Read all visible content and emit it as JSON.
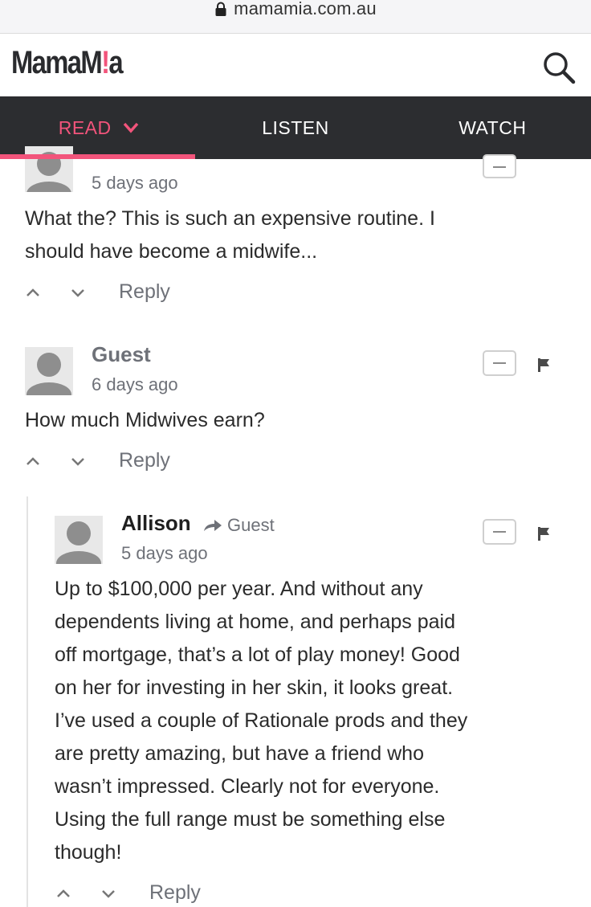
{
  "browser": {
    "url": "mamamia.com.au"
  },
  "header": {
    "logo_part1": "MamaM",
    "logo_dot": "!",
    "logo_part2": "a"
  },
  "nav": {
    "items": [
      {
        "label": "READ"
      },
      {
        "label": "LISTEN"
      },
      {
        "label": "WATCH"
      }
    ]
  },
  "comments": [
    {
      "time": "5 days ago",
      "text_lines": [
        "What the? This is such an expensive routine. I",
        "should have become a midwife..."
      ],
      "reply": "Reply"
    },
    {
      "author": "Guest",
      "time": "6 days ago",
      "text_lines": [
        "How much Midwives earn?"
      ],
      "reply": "Reply"
    },
    {
      "author": "Allison",
      "reply_to": "Guest",
      "time": "5 days ago",
      "text_lines": [
        "Up to $100,000 per year. And without any",
        "dependents living at home, and perhaps paid",
        "off mortgage, that’s a lot of play money! Good",
        "on her for investing in her skin, it looks great.",
        "I’ve used a couple of Rationale prods and they",
        "are pretty amazing, but have a friend who",
        "wasn’t impressed. Clearly not for everyone.",
        "Using the full range must be something else",
        "though!"
      ],
      "reply": "Reply"
    }
  ]
}
